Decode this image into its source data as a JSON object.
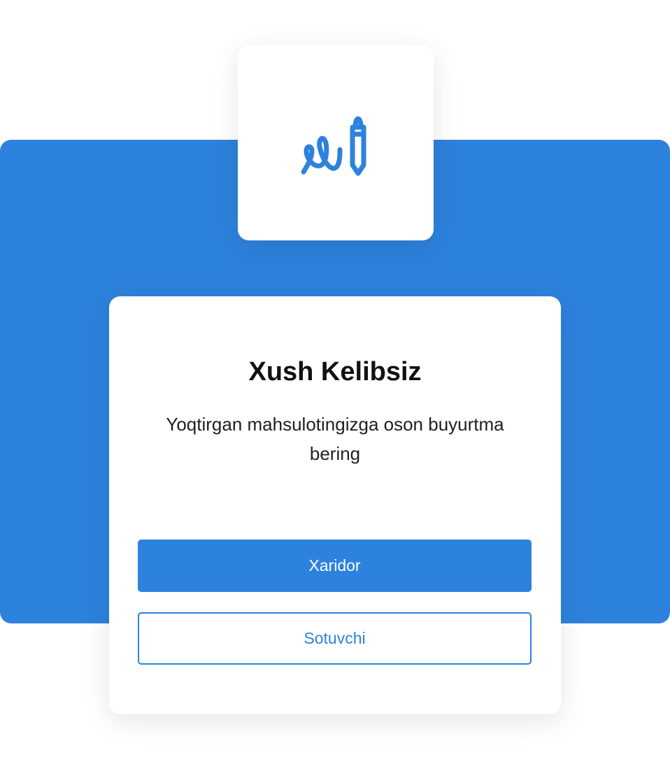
{
  "colors": {
    "accent": "#2D82DD",
    "card": "#FFFFFF",
    "title_text": "#111111"
  },
  "logo": {
    "icon": "signature-pen-icon"
  },
  "welcome": {
    "title": "Xush Kelibsiz",
    "subtitle": "Yoqtirgan mahsulotingizga oson buyurtma bering"
  },
  "actions": {
    "buyer_label": "Xaridor",
    "seller_label": "Sotuvchi"
  }
}
